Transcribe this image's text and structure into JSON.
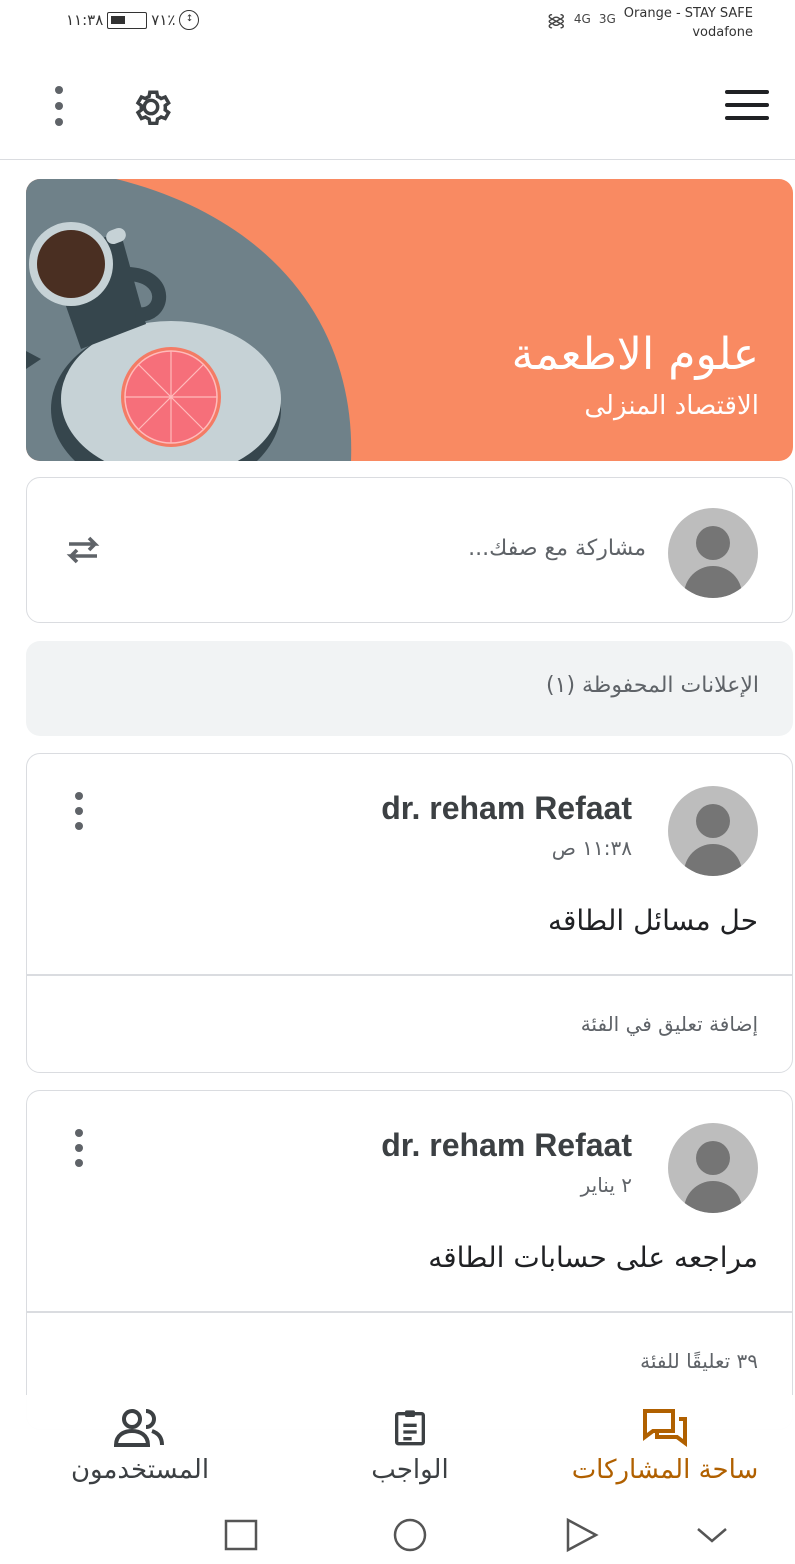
{
  "status_bar": {
    "time": "١١:٣٨",
    "battery": "٧١٪",
    "signal_1": "4G",
    "signal_2": "3G",
    "carrier_1": "Orange - STAY SAFE",
    "carrier_2": "vodafone"
  },
  "app_bar": {
    "icons": [
      "more-vert-icon",
      "gear-icon",
      "hamburger-menu-icon"
    ]
  },
  "banner": {
    "title": "علوم الاطعمة",
    "subtitle": "الاقتصاد المنزلى",
    "color": "#f98a62"
  },
  "share": {
    "placeholder": "مشاركة مع صفك..."
  },
  "saved_announcements": {
    "label": "الإعلانات المحفوظة (١)"
  },
  "posts": [
    {
      "author": "dr. reham Refaat",
      "time": "١١:٣٨ ص",
      "body": "حل مسائل الطاقه",
      "comment": "إضافة تعليق في الفئة"
    },
    {
      "author": "dr. reham Refaat",
      "time": "٢ يناير",
      "body": "مراجعه على حسابات الطاقه",
      "comment": "٣٩ تعليقًا للفئة"
    }
  ],
  "bottom_nav": {
    "items": [
      {
        "label": "ساحة المشاركات",
        "icon": "forum-icon",
        "active": true
      },
      {
        "label": "الواجب",
        "icon": "assignment-icon",
        "active": false
      },
      {
        "label": "المستخدمون",
        "icon": "people-icon",
        "active": false
      }
    ],
    "active_color": "#b06000"
  },
  "system_nav": {
    "icons": [
      "recents-icon",
      "home-icon",
      "back-icon",
      "collapse-icon"
    ]
  }
}
